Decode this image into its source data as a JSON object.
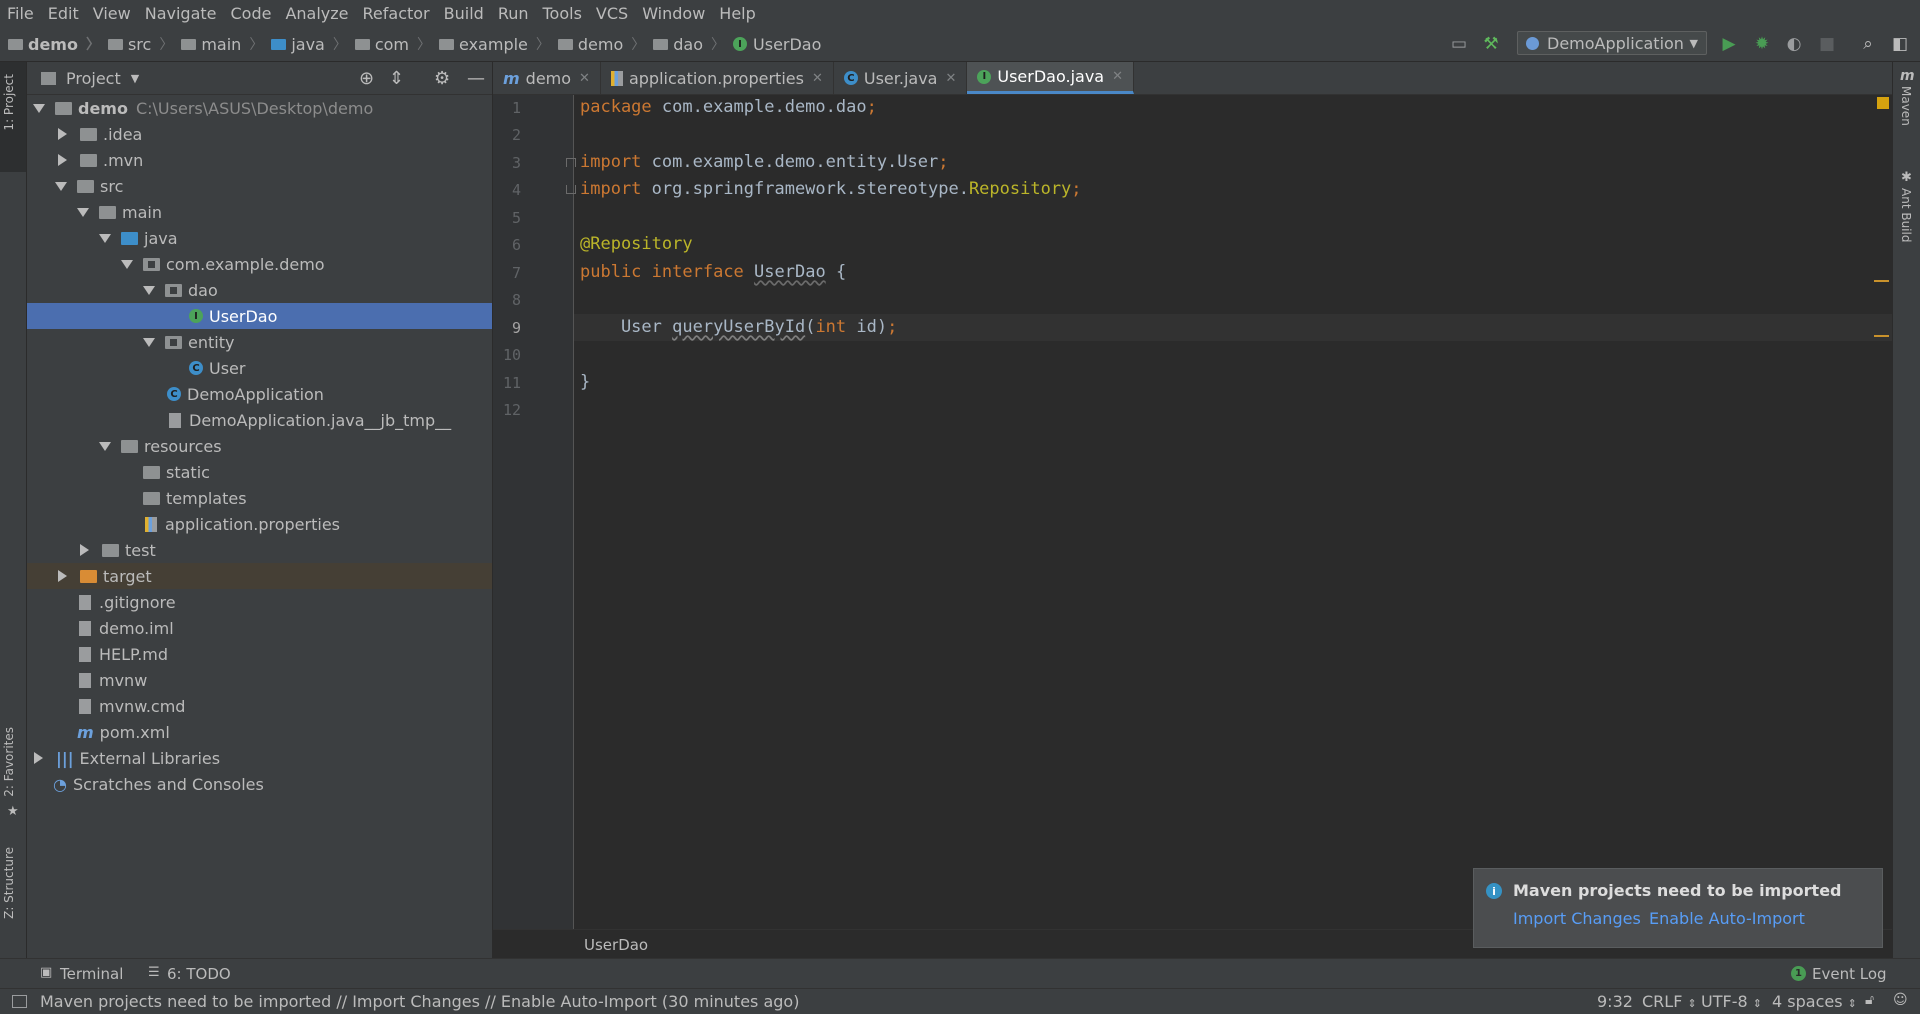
{
  "menu": [
    "File",
    "Edit",
    "View",
    "Navigate",
    "Code",
    "Analyze",
    "Refactor",
    "Build",
    "Run",
    "Tools",
    "VCS",
    "Window",
    "Help"
  ],
  "nav_crumbs": [
    "demo",
    "src",
    "main",
    "java",
    "com",
    "example",
    "demo",
    "dao",
    "UserDao"
  ],
  "run_config": "DemoApplication",
  "project_panel": {
    "title": "Project",
    "root_name": "demo",
    "root_path": "C:\\Users\\ASUS\\Desktop\\demo",
    "items": [
      ".idea",
      ".mvn",
      "src",
      "main",
      "java",
      "com.example.demo",
      "dao",
      "UserDao",
      "entity",
      "User",
      "DemoApplication",
      "DemoApplication.java__jb_tmp__",
      "resources",
      "static",
      "templates",
      "application.properties",
      "test",
      "target",
      ".gitignore",
      "demo.iml",
      "HELP.md",
      "mvnw",
      "mvnw.cmd",
      "pom.xml",
      "External Libraries",
      "Scratches and Consoles"
    ]
  },
  "tabs": [
    {
      "label": "demo",
      "icon": "maven-m-icon"
    },
    {
      "label": "application.properties",
      "icon": "properties-icon"
    },
    {
      "label": "User.java",
      "icon": "class-icon"
    },
    {
      "label": "UserDao.java",
      "icon": "interface-icon",
      "active": true
    }
  ],
  "editor": {
    "line_numbers": [
      "1",
      "2",
      "3",
      "4",
      "5",
      "6",
      "7",
      "8",
      "9",
      "10",
      "11",
      "12"
    ],
    "lines": {
      "l1_kw": "package",
      "l1_rest": " com.example.demo.dao",
      "l1_semi": ";",
      "l3_kw": "import",
      "l3_rest": " com.example.demo.entity.User",
      "l3_semi": ";",
      "l4_kw": "import",
      "l4_rest": " org.springframework.stereotype.",
      "l4_cls": "Repository",
      "l4_semi": ";",
      "l6_ann": "@Repository",
      "l7_kw1": "public",
      "l7_kw2": "interface",
      "l7_name": "UserDao",
      "l7_brace": " {",
      "l9_type": "    User ",
      "l9_method": "queryUserById",
      "l9_open": "(",
      "l9_kw": "int",
      "l9_param": " id)",
      "l9_semi": ";",
      "l11_brace": "}"
    },
    "cursor_line": 9,
    "structure_crumb": "UserDao"
  },
  "right_tools": [
    "Maven",
    "Ant Build"
  ],
  "left_tools": [
    "1: Project",
    "2: Favorites",
    "Z: Structure"
  ],
  "notification": {
    "title": "Maven projects need to be imported",
    "link1": "Import Changes",
    "link2": "Enable Auto-Import"
  },
  "bottom_tools": [
    "Terminal",
    "6: TODO"
  ],
  "event_log": "Event Log",
  "status": {
    "message": "Maven projects need to be imported // Import Changes // Enable Auto-Import (30 minutes ago)",
    "position": "9:32",
    "line_sep": "CRLF",
    "encoding": "UTF-8",
    "indent": "4 spaces"
  },
  "colors": {
    "selection": "#4b6eaf",
    "keyword": "#cc7832",
    "annotation": "#bbb529",
    "link": "#589df6",
    "run": "#499c54"
  }
}
